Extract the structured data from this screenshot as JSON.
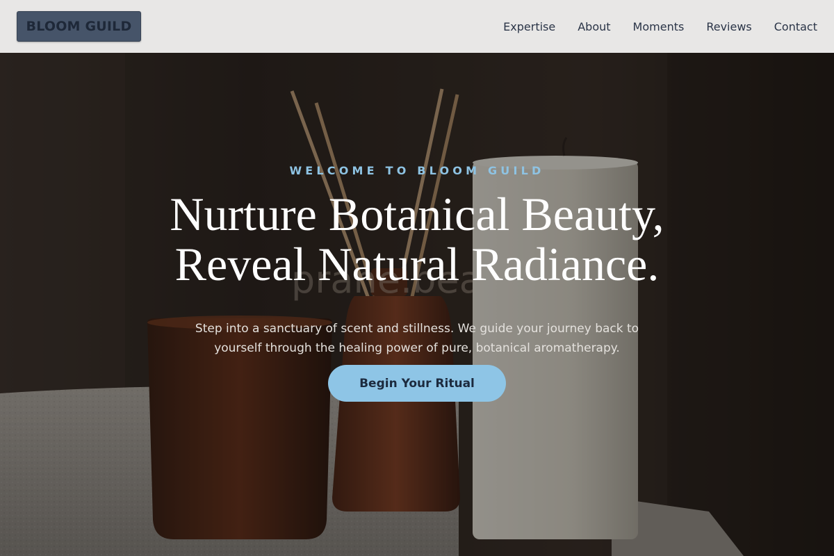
{
  "header": {
    "logo_text": "BLOOM GUILD",
    "nav": [
      {
        "label": "Expertise"
      },
      {
        "label": "About"
      },
      {
        "label": "Moments"
      },
      {
        "label": "Reviews"
      },
      {
        "label": "Contact"
      }
    ]
  },
  "hero": {
    "eyebrow": "WELCOME TO BLOOM GUILD",
    "headline_line1": "Nurture Botanical Beauty,",
    "headline_line2": "Reveal Natural Radiance.",
    "subtext": "Step into a sanctuary of scent and stillness. We guide your journey back to yourself through the healing power of pure, botanical aromatherapy.",
    "cta_label": "Begin Your Ritual",
    "background_image_text": "prane.beauty"
  },
  "colors": {
    "header_bg": "#e8e7e6",
    "logo_bg": "#465469",
    "accent": "#8ec5e6",
    "nav_text": "#2a3447"
  }
}
